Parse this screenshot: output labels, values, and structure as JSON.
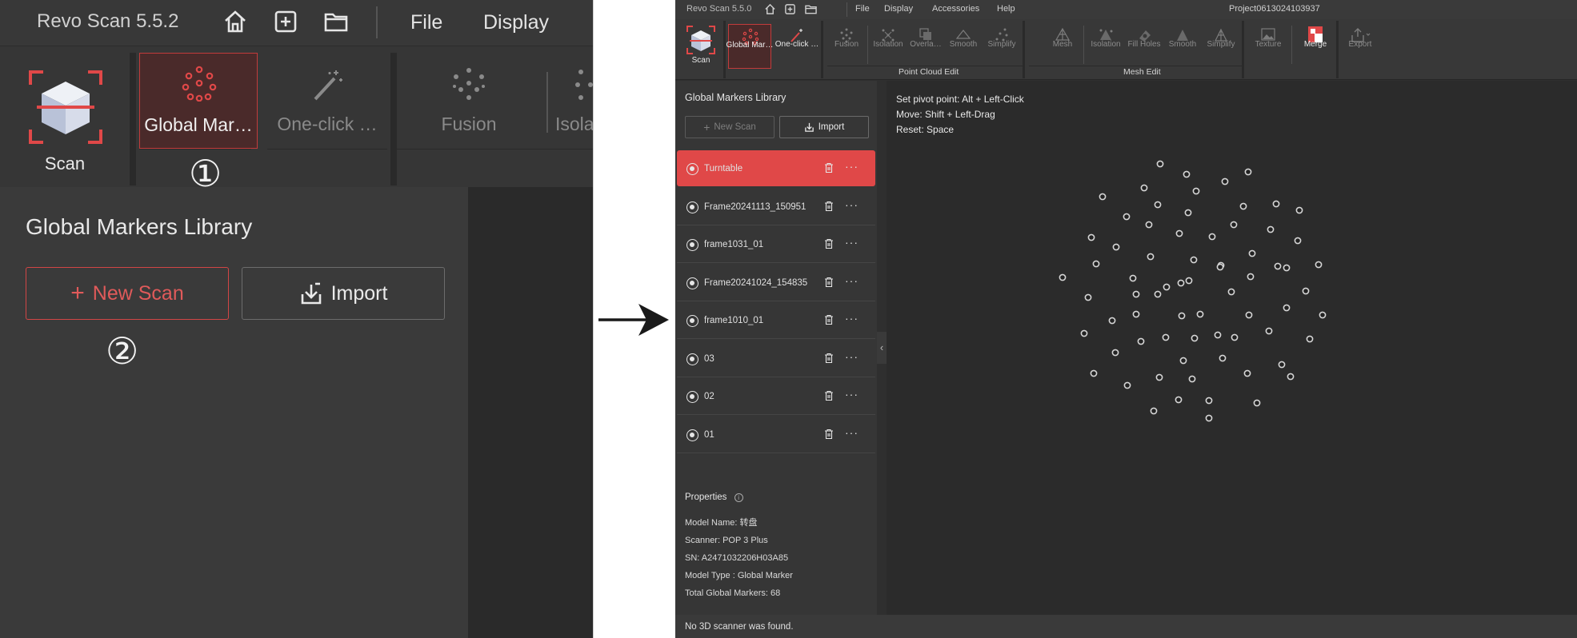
{
  "zoom": {
    "app_name": "Revo Scan 5.5.2",
    "menu": [
      "File",
      "Display"
    ],
    "scan_label": "Scan",
    "tools": [
      "Global Mar…",
      "One-click …",
      "Fusion",
      "Isola"
    ],
    "markers": {
      "one": "①",
      "two": "②"
    },
    "panel_title": "Global Markers Library",
    "new_scan": "New Scan",
    "import": "Import"
  },
  "app": {
    "app_name": "Revo Scan 5.5.0",
    "menu": [
      "File",
      "Display",
      "Accessories",
      "Help"
    ],
    "project": "Project0613024103937",
    "ribbon": {
      "scan": "Scan",
      "global": "Global Mar…",
      "oneclick": "One-click …",
      "fusion": "Fusion",
      "isolation": "Isolation",
      "overlap": "Overla…",
      "smooth": "Smooth",
      "simplify": "Simplify",
      "mesh": "Mesh",
      "isolation2": "Isolation",
      "fill_holes": "Fill Holes",
      "smooth2": "Smooth",
      "simplify2": "Simplify",
      "texture": "Texture",
      "merge": "Merge",
      "export": "Export",
      "group_pc": "Point Cloud Edit",
      "group_mesh": "Mesh Edit"
    },
    "side": {
      "title": "Global Markers Library",
      "new_scan": "New Scan",
      "import": "Import",
      "items": [
        "Turntable",
        "Frame20241113_150951",
        "frame1031_01",
        "Frame20241024_154835",
        "frame1010_01",
        "03",
        "02",
        "01"
      ]
    },
    "props": {
      "header": "Properties",
      "model_name_label": "Model Name:",
      "model_name": "转盘",
      "scanner_label": "Scanner:",
      "scanner": "POP 3 Plus",
      "sn_label": "SN:",
      "sn": "A2471032206H03A85",
      "model_type_label": "Model Type :",
      "model_type": "Global Marker",
      "total_label": "Total Global Markers:",
      "total": "68"
    },
    "hints": [
      {
        "label": "Set pivot point:",
        "value": "Alt + Left-Click"
      },
      {
        "label": "Move:",
        "value": "Shift + Left-Drag"
      },
      {
        "label": "Reset:",
        "value": "Space"
      }
    ],
    "status": "No 3D scanner was found."
  }
}
